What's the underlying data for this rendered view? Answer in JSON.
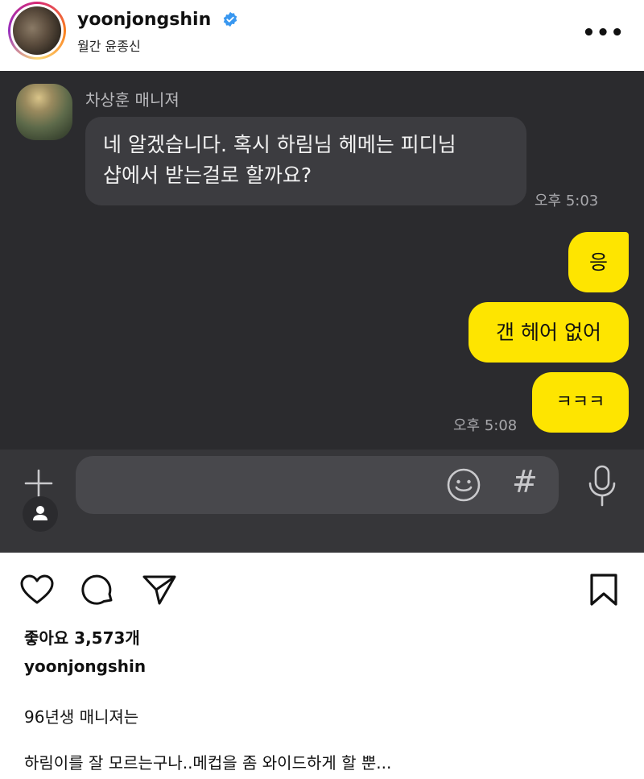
{
  "header": {
    "username": "yoonjongshin",
    "subtitle": "월간 윤종신",
    "more_label": "•••",
    "verified_icon": "verified-badge-icon",
    "accent_color": "#3897f0"
  },
  "chat": {
    "sender_name": "차상훈 매니져",
    "incoming_message_line1": "네 알겠습니다. 혹시 하림님 헤메는 피디님",
    "incoming_message_line2": "샵에서 받는걸로 할까요?",
    "incoming_time": "오후 5:03",
    "outgoing_messages": [
      "응",
      "갠 헤어 없어",
      "ㅋㅋㅋ"
    ],
    "outgoing_time": "오후 5:08",
    "input_value": "",
    "colors": {
      "background": "#2b2b2e",
      "incoming_bubble": "#3c3c40",
      "outgoing_bubble": "#fee500"
    },
    "hash_label": "#"
  },
  "post": {
    "likes": "좋아요 3,573개",
    "username": "yoonjongshin",
    "caption_line1": "96년생 매니져는",
    "caption_line2": "하림이를 잘 모르는구나..메컵을 좀 와이드하게 할 뿐..."
  }
}
